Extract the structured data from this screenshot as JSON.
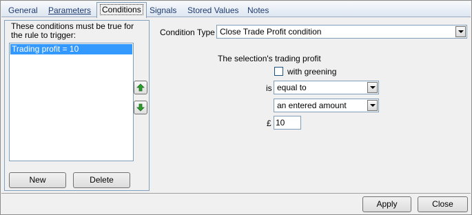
{
  "tabs": [
    {
      "label": "General"
    },
    {
      "label": "Parameters"
    },
    {
      "label": "Conditions"
    },
    {
      "label": "Signals"
    },
    {
      "label": "Stored Values"
    },
    {
      "label": "Notes"
    }
  ],
  "conditions_panel": {
    "title": "These conditions must be true for the rule to trigger:",
    "items": [
      "Trading profit = 10"
    ],
    "new_button": "New",
    "delete_button": "Delete"
  },
  "condition_type": {
    "label": "Condition Type",
    "value": "Close Trade Profit condition"
  },
  "detail": {
    "heading": "The selection's trading profit",
    "with_greening_label": "with greening",
    "with_greening_checked": false,
    "is_label": "is",
    "operator_value": "equal to",
    "source_value": "an entered amount",
    "currency_symbol": "£",
    "amount_value": "10"
  },
  "footer": {
    "apply_button": "Apply",
    "close_button": "Close"
  },
  "colors": {
    "selection": "#3399ff",
    "arrow_green": "#2e9b2e"
  },
  "icons": {
    "move_up": "arrow-up-icon",
    "move_down": "arrow-down-icon"
  }
}
